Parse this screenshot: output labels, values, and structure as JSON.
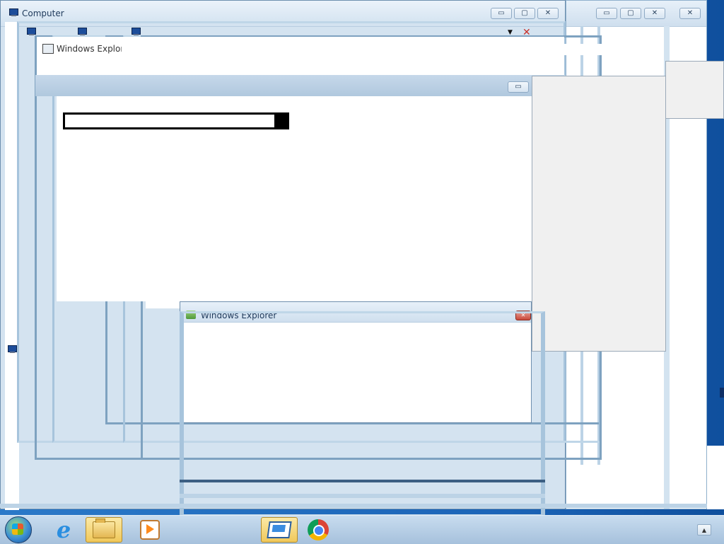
{
  "windows": {
    "computer": {
      "title": "Computer"
    },
    "explorer_back": {
      "title": "Windows Explorer"
    },
    "explorer_front": {
      "title": "Windows Explorer"
    }
  },
  "window_controls": {
    "minimize": "▭",
    "maximize": "▢",
    "close": "✕"
  },
  "icons": {
    "computer": "monitor-icon",
    "explorer": "folder-icon",
    "address_dropdown": "chevron-down-icon",
    "address_stop": "stop-icon"
  },
  "taskbar": {
    "items": [
      {
        "name": "start-button",
        "icon": "windows-orb-icon"
      },
      {
        "name": "internet-explorer",
        "icon": "ie-icon"
      },
      {
        "name": "windows-explorer",
        "icon": "folder-icon",
        "active": true
      },
      {
        "name": "windows-media-player",
        "icon": "media-icon"
      },
      {
        "name": "remote-desktop",
        "icon": "rdp-icon",
        "active": true
      },
      {
        "name": "google-chrome",
        "icon": "chrome-icon"
      }
    ],
    "tray_arrow": "▲"
  },
  "colors": {
    "desktop": "#1c6fc4",
    "taskbar": "#b6cfe6",
    "frame": "#bfd6e8",
    "active_taskbar": "#f0c85a",
    "close_red": "#c9483a"
  }
}
